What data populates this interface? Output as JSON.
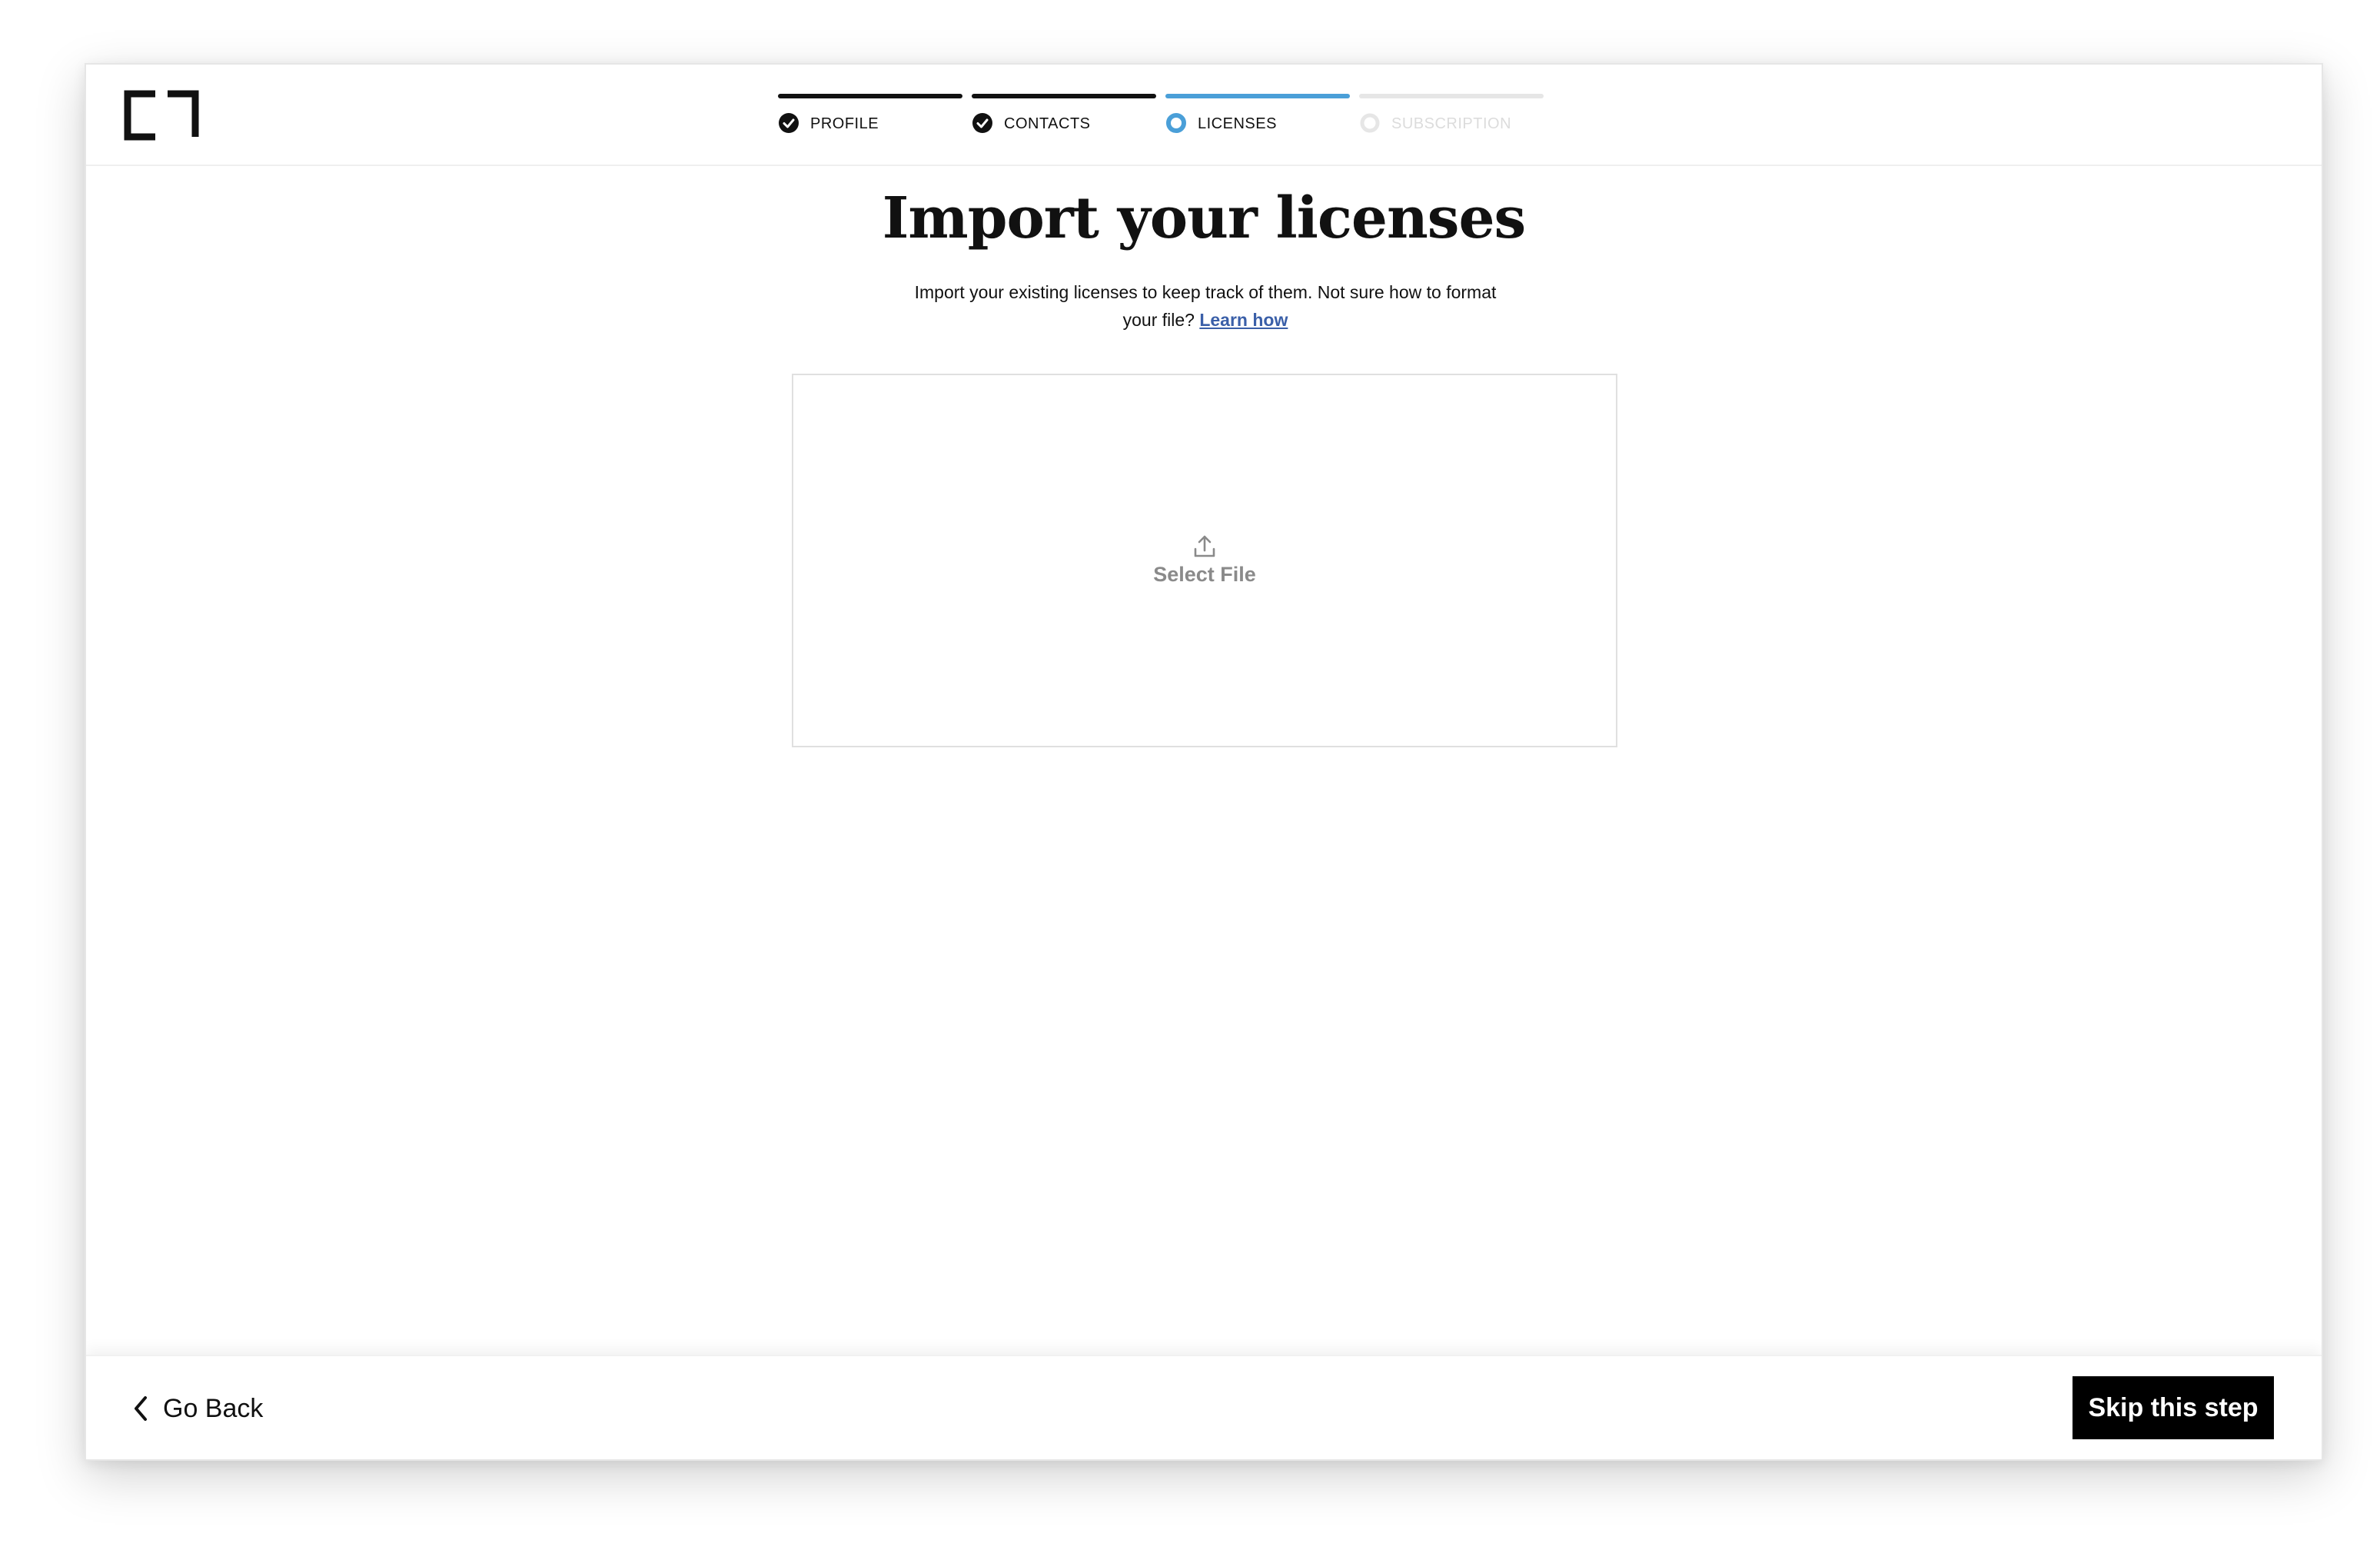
{
  "stepper": {
    "steps": [
      {
        "label": "PROFILE",
        "state": "complete"
      },
      {
        "label": "CONTACTS",
        "state": "complete"
      },
      {
        "label": "LICENSES",
        "state": "active"
      },
      {
        "label": "SUBSCRIPTION",
        "state": "upcoming"
      }
    ]
  },
  "main": {
    "title": "Import your licenses",
    "subtitle": "Import your existing licenses to keep track of them. Not sure how to format your file?",
    "learn_link": "Learn how",
    "dropzone_label": "Select File"
  },
  "footer": {
    "back_label": "Go Back",
    "skip_label": "Skip this step"
  },
  "icons": {
    "logo": "bracket-logo-icon",
    "complete": "check-circle-icon",
    "active": "ring-icon",
    "upcoming": "ring-icon",
    "upload": "upload-icon",
    "back": "chevron-left-icon"
  },
  "colors": {
    "complete": "#111111",
    "active": "#4a9fd8",
    "upcoming": "#e6e6e6",
    "upcoming_text": "#dcdcdc",
    "link": "#3a5fa8",
    "button_bg": "#000000"
  }
}
